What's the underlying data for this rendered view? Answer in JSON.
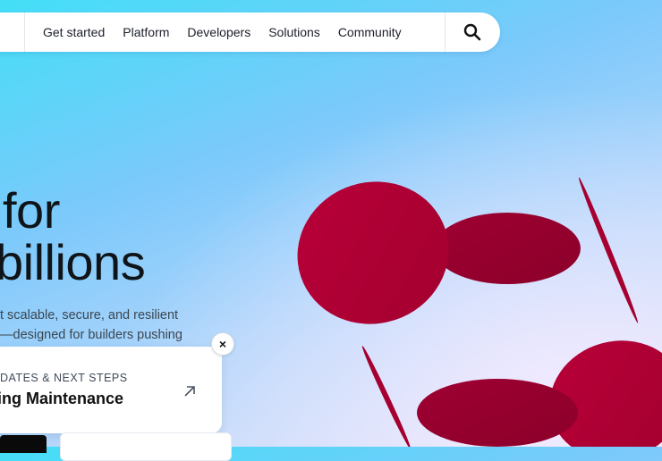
{
  "nav": {
    "items": [
      {
        "label": "Get started"
      },
      {
        "label": "Platform"
      },
      {
        "label": "Developers"
      },
      {
        "label": "Solutions"
      },
      {
        "label": "Community"
      }
    ],
    "search_icon": "search-icon"
  },
  "hero": {
    "title_line1": "for",
    "title_line2": "billions",
    "subtitle_line1": "t scalable, secure, and resilient",
    "subtitle_line2": "—designed for builders pushing"
  },
  "notice": {
    "eyebrow": "DATES & NEXT STEPS",
    "title": "ning Maintenance",
    "arrow_icon": "arrow-up-right-icon",
    "close_label": "×"
  },
  "colors": {
    "accent_red": "#b0003a",
    "accent_red_dark": "#94002e"
  }
}
